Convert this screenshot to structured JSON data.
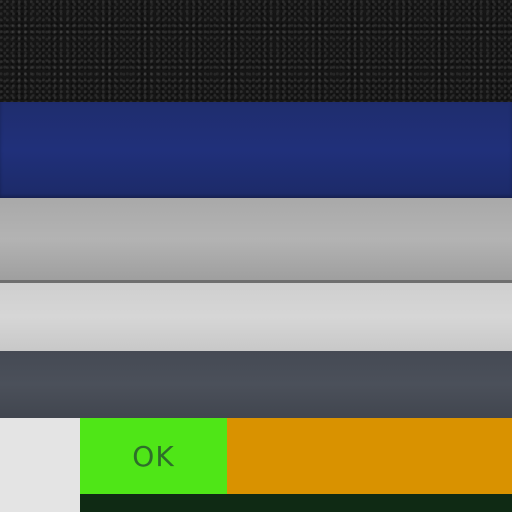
{
  "ok_button": {
    "label": "OK"
  },
  "colors": {
    "texture": "#161616",
    "blue_bar": "#20307a",
    "gray_bar": "#b3b3b3",
    "light_bar": "#d6d6d6",
    "slate_bar": "#4b505a",
    "left_panel": "#e4e4e4",
    "ok_button": "#4fe617",
    "ok_text": "#2e6e2a",
    "orange_panel": "#d99200",
    "bottom_strip": "#0f2a14"
  }
}
